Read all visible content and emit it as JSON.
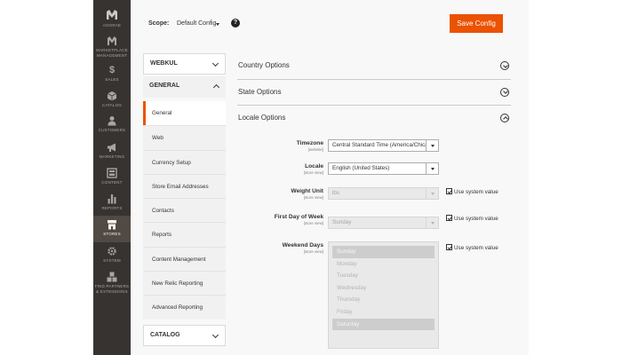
{
  "admin_nav": {
    "logo_label": "AGORAE",
    "items": [
      {
        "label": "MARKETPLACE MANAGEMENT",
        "icon": "marketplace-icon"
      },
      {
        "label": "SALES",
        "icon": "dollar-icon"
      },
      {
        "label": "CATALOG",
        "icon": "box-icon"
      },
      {
        "label": "CUSTOMERS",
        "icon": "person-icon"
      },
      {
        "label": "MARKETING",
        "icon": "megaphone-icon"
      },
      {
        "label": "CONTENT",
        "icon": "layout-icon"
      },
      {
        "label": "REPORTS",
        "icon": "bar-chart-icon"
      },
      {
        "label": "STORES",
        "icon": "store-icon"
      },
      {
        "label": "SYSTEM",
        "icon": "gear-icon"
      },
      {
        "label": "FIND PARTNERS & EXTENSIONS",
        "icon": "cubes-icon"
      }
    ],
    "active": "STORES"
  },
  "header": {
    "scope_label": "Scope:",
    "scope_value": "Default Config",
    "help_symbol": "?",
    "save_label": "Save Config",
    "accent_color": "#eb5202"
  },
  "config_nav": {
    "sections": [
      {
        "label": "WEBKUL",
        "expanded": false
      },
      {
        "label": "GENERAL",
        "expanded": true
      },
      {
        "label": "CATALOG",
        "expanded": false
      }
    ],
    "general_items": [
      "General",
      "Web",
      "Currency Setup",
      "Store Email Addresses",
      "Contacts",
      "Reports",
      "Content Management",
      "New Relic Reporting",
      "Advanced Reporting"
    ],
    "current_item": "General"
  },
  "groups": [
    {
      "title": "Country Options",
      "expanded": false
    },
    {
      "title": "State Options",
      "expanded": false
    },
    {
      "title": "Locale Options",
      "expanded": true
    }
  ],
  "locale": {
    "timezone": {
      "label": "Timezone",
      "scope": "[website]",
      "value": "Central Standard Time (America/Chicago)"
    },
    "locale": {
      "label": "Locale",
      "scope": "[store view]",
      "value": "English (United States)"
    },
    "weight_unit": {
      "label": "Weight Unit",
      "scope": "[store view]",
      "value": "lbs",
      "use_system": "Use system value",
      "use_system_checked": true
    },
    "first_day": {
      "label": "First Day of Week",
      "scope": "[store view]",
      "value": "Sunday",
      "use_system": "Use system value",
      "use_system_checked": true
    },
    "weekend_days": {
      "label": "Weekend Days",
      "scope": "[store view]",
      "options": [
        "Sunday",
        "Monday",
        "Tuesday",
        "Wednesday",
        "Thursday",
        "Friday",
        "Saturday"
      ],
      "selected": [
        "Sunday",
        "Saturday"
      ],
      "use_system": "Use system value",
      "use_system_checked": true
    }
  }
}
